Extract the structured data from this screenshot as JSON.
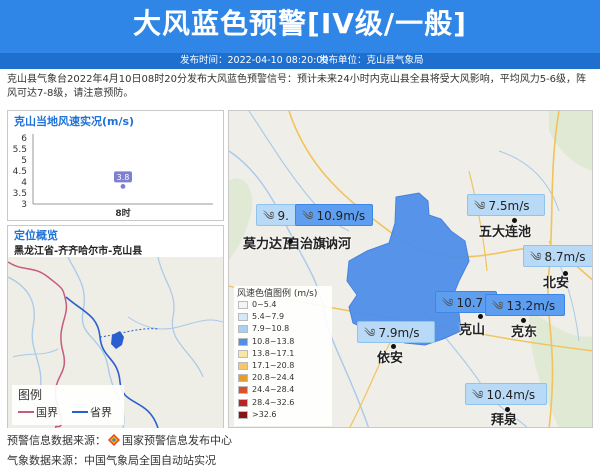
{
  "header": {
    "title": "大风蓝色预警[IV级/一般]",
    "publish_time": "发布时间：2022-04-10 08:20:00",
    "publish_unit": "发布单位：克山县气象局"
  },
  "description": "克山县气象台2022年4月10日08时20分发布大风蓝色预警信号：预计未来24小时内克山县全县将受大风影响，平均风力5-6级，阵风可达7-8级，请注意预防。",
  "chart_panel": {
    "title": "克山当地风速实况(m/s)"
  },
  "chart_data": {
    "type": "scatter",
    "title": "克山当地风速实况(m/s)",
    "categories": [
      "8时"
    ],
    "values": [
      3.8
    ],
    "data_labels": [
      "3.8"
    ],
    "yticks": [
      "6",
      "5.5",
      "5",
      "4.5",
      "4",
      "3.5",
      "3"
    ],
    "ylim": [
      3,
      6
    ],
    "point_color": "#7e7fd0"
  },
  "location_panel": {
    "title": "定位概览",
    "path": "黑龙江省-齐齐哈尔市-克山县",
    "legend_title": "图例",
    "legend_items": [
      {
        "label": "国界",
        "color": "#c65b7c"
      },
      {
        "label": "省界",
        "color": "#2a5fcf"
      }
    ]
  },
  "map": {
    "places": [
      {
        "name": "五大连池"
      },
      {
        "name": "北安"
      },
      {
        "name": "克山"
      },
      {
        "name": "克东"
      },
      {
        "name": "依安"
      },
      {
        "name": "拜泉"
      },
      {
        "name": "莫力达瓦"
      },
      {
        "name": "自治旗"
      },
      {
        "name": "讷河"
      }
    ],
    "wind_boxes": [
      {
        "value": "9.",
        "level": "light"
      },
      {
        "value": "10.9m/s",
        "level": "strong"
      },
      {
        "value": "7.5m/s",
        "level": "light"
      },
      {
        "value": "8.7m/s",
        "level": "light"
      },
      {
        "value": "10.7",
        "level": "strong"
      },
      {
        "value": "13.2m/s",
        "level": "strong"
      },
      {
        "value": "7.9m/s",
        "level": "light"
      },
      {
        "value": "10.4m/s",
        "level": "light"
      }
    ],
    "wind_icon": "wind-icon",
    "legend": {
      "title": "风速色值图例 (m/s)",
      "items": [
        {
          "range": "0~5.4",
          "color": "#f4f4f4"
        },
        {
          "range": "5.4~7.9",
          "color": "#d4e8f8"
        },
        {
          "range": "7.9~10.8",
          "color": "#a9d0f3"
        },
        {
          "range": "10.8~13.8",
          "color": "#4f8fe8"
        },
        {
          "range": "13.8~17.1",
          "color": "#f7e7a0"
        },
        {
          "range": "17.1~20.8",
          "color": "#f4c86a"
        },
        {
          "range": "20.8~24.4",
          "color": "#e89a2e"
        },
        {
          "range": "24.4~28.4",
          "color": "#d5542a"
        },
        {
          "range": "28.4~32.6",
          "color": "#b82323"
        },
        {
          "range": ">32.6",
          "color": "#8a1414"
        }
      ]
    }
  },
  "footer": {
    "warning_source_label": "预警信息数据来源：",
    "warning_source": "国家预警信息发布中心",
    "weather_source_label": "气象数据来源：",
    "weather_source": "中国气象局全国自动站实况"
  }
}
